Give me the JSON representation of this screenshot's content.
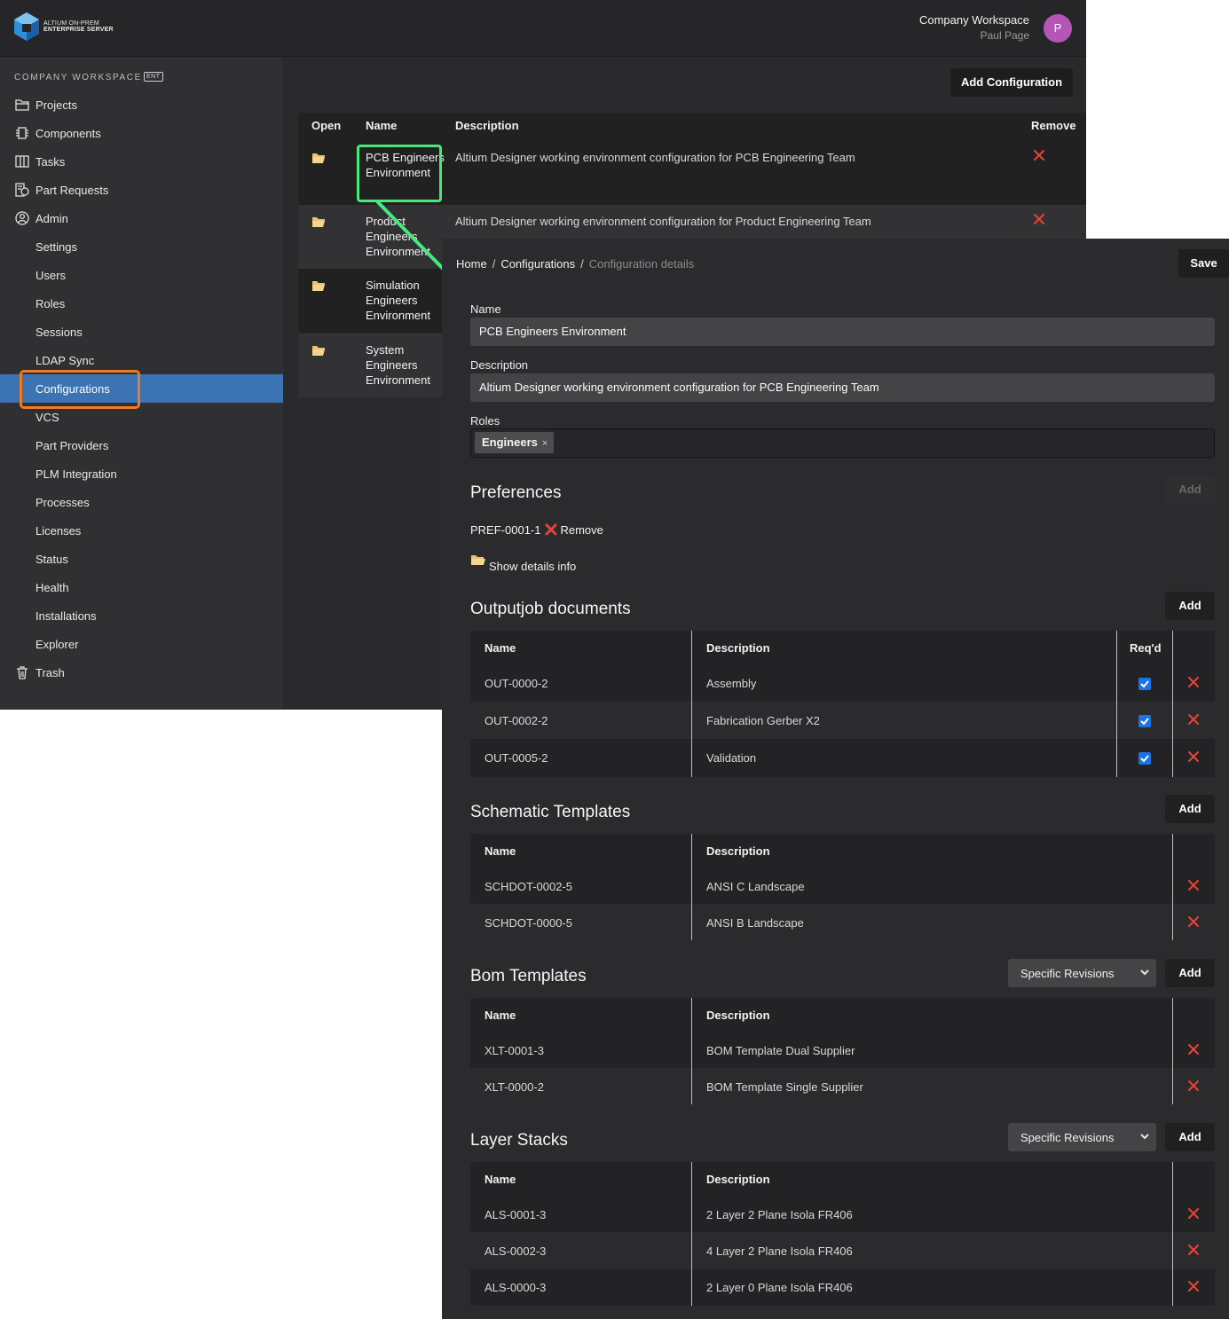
{
  "brand": {
    "line1": "ALTIUM ON-PREM",
    "line2": "ENTERPRISE SERVER"
  },
  "header": {
    "workspace": "Company Workspace",
    "user": "Paul Page",
    "avatar_letter": "P"
  },
  "sidebar": {
    "title": "COMPANY WORKSPACE",
    "badge": "ENT",
    "items": [
      {
        "label": "Projects",
        "icon": "folder-icon"
      },
      {
        "label": "Components",
        "icon": "chip-icon"
      },
      {
        "label": "Tasks",
        "icon": "board-icon"
      },
      {
        "label": "Part Requests",
        "icon": "part-request-icon"
      },
      {
        "label": "Admin",
        "icon": "user-circle-icon"
      },
      {
        "label": "Settings"
      },
      {
        "label": "Users"
      },
      {
        "label": "Roles"
      },
      {
        "label": "Sessions"
      },
      {
        "label": "LDAP Sync"
      },
      {
        "label": "Configurations",
        "active": true
      },
      {
        "label": "VCS"
      },
      {
        "label": "Part Providers"
      },
      {
        "label": "PLM Integration"
      },
      {
        "label": "Processes"
      },
      {
        "label": "Licenses"
      },
      {
        "label": "Status"
      },
      {
        "label": "Health"
      },
      {
        "label": "Installations"
      },
      {
        "label": "Explorer"
      },
      {
        "label": "Trash",
        "icon": "trash-icon"
      }
    ]
  },
  "config_list": {
    "add_label": "Add Configuration",
    "columns": {
      "open": "Open",
      "name": "Name",
      "description": "Description",
      "remove": "Remove"
    },
    "rows": [
      {
        "name": "PCB Engineers Environment",
        "description": "Altium Designer working environment configuration for PCB Engineering Team"
      },
      {
        "name": "Product Engineers Environment",
        "description": "Altium Designer working environment configuration for Product Engineering Team"
      },
      {
        "name": "Simulation Engineers Environment",
        "description": ""
      },
      {
        "name": "System Engineers Environment",
        "description": ""
      }
    ]
  },
  "detail": {
    "breadcrumb": {
      "home": "Home",
      "configurations": "Configurations",
      "current": "Configuration details",
      "sep": "/"
    },
    "save_label": "Save",
    "name_label": "Name",
    "name_value": "PCB Engineers Environment",
    "description_label": "Description",
    "description_value": "Altium Designer working environment configuration for PCB Engineering Team",
    "roles_label": "Roles",
    "role_chip": "Engineers",
    "role_chip_x": "×",
    "add_label": "Add",
    "preferences": {
      "title": "Preferences",
      "item": "PREF-0001-1",
      "remove_label": "Remove",
      "show_details": "Show details info"
    },
    "outputjob": {
      "title": "Outputjob documents",
      "col_name": "Name",
      "col_description": "Description",
      "col_reqd": "Req'd",
      "rows": [
        {
          "name": "OUT-0000-2",
          "description": "Assembly",
          "required": true
        },
        {
          "name": "OUT-0002-2",
          "description": "Fabrication Gerber X2",
          "required": true
        },
        {
          "name": "OUT-0005-2",
          "description": "Validation",
          "required": true
        }
      ]
    },
    "schematic": {
      "title": "Schematic Templates",
      "col_name": "Name",
      "col_description": "Description",
      "rows": [
        {
          "name": "SCHDOT-0002-5",
          "description": "ANSI C Landscape"
        },
        {
          "name": "SCHDOT-0000-5",
          "description": "ANSI B Landscape"
        }
      ]
    },
    "bom": {
      "title": "Bom Templates",
      "select_value": "Specific Revisions",
      "col_name": "Name",
      "col_description": "Description",
      "rows": [
        {
          "name": "XLT-0001-3",
          "description": "BOM Template Dual Supplier"
        },
        {
          "name": "XLT-0000-2",
          "description": "BOM Template Single Supplier"
        }
      ]
    },
    "layer": {
      "title": "Layer Stacks",
      "select_value": "Specific Revisions",
      "col_name": "Name",
      "col_description": "Description",
      "rows": [
        {
          "name": "ALS-0001-3",
          "description": "2 Layer 2 Plane Isola FR406"
        },
        {
          "name": "ALS-0002-3",
          "description": "4 Layer 2 Plane Isola FR406"
        },
        {
          "name": "ALS-0000-3",
          "description": "2 Layer 0 Plane Isola FR406"
        }
      ]
    }
  },
  "colors": {
    "accent": "#3b73b5",
    "highlight_orange": "#f07a23",
    "highlight_green": "#48e87c",
    "remove_red": "#e8433a",
    "checkbox_blue": "#1a73e8",
    "avatar": "#b455b8"
  }
}
